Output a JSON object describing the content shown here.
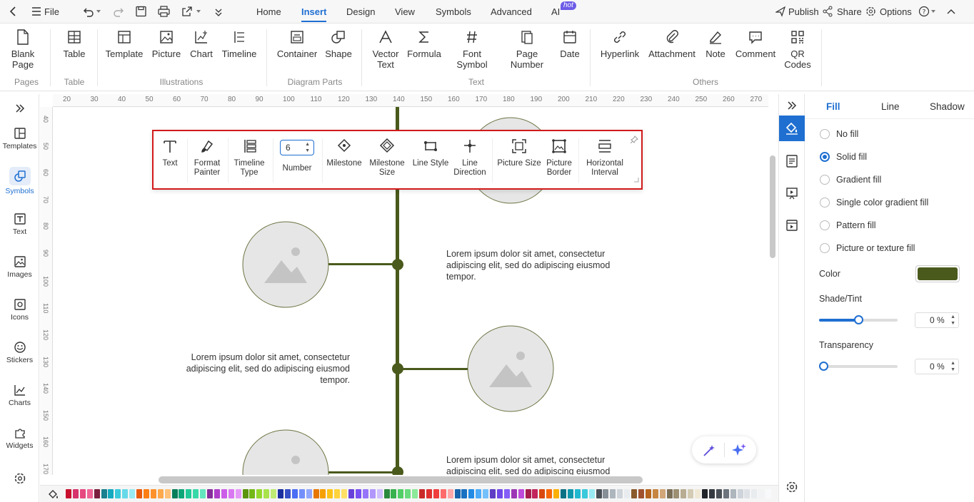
{
  "topbar": {
    "file": "File",
    "tabs": [
      "Home",
      "Insert",
      "Design",
      "View",
      "Symbols",
      "Advanced",
      "AI"
    ],
    "hot": "hot",
    "publish": "Publish",
    "share": "Share",
    "options": "Options"
  },
  "ribbon": {
    "buttons": {
      "blank_page": "Blank Page",
      "table": "Table",
      "template": "Template",
      "picture": "Picture",
      "chart": "Chart",
      "timeline": "Timeline",
      "container": "Container",
      "shape": "Shape",
      "vector_text": "Vector Text",
      "formula": "Formula",
      "font_symbol": "Font Symbol",
      "page_number": "Page Number",
      "date": "Date",
      "hyperlink": "Hyperlink",
      "attachment": "Attachment",
      "note": "Note",
      "comment": "Comment",
      "qr_codes": "QR Codes"
    },
    "groups": {
      "pages": "Pages",
      "table": "Table",
      "illustrations": "Illustrations",
      "diagram_parts": "Diagram Parts",
      "text": "Text",
      "others": "Others"
    }
  },
  "leftbar": [
    "Templates",
    "Symbols",
    "Text",
    "Images",
    "Icons",
    "Stickers",
    "Charts",
    "Widgets"
  ],
  "ruler": {
    "top": [
      "20",
      "30",
      "40",
      "50",
      "60",
      "70",
      "80",
      "90",
      "100",
      "110",
      "120",
      "130",
      "140",
      "150",
      "160",
      "170",
      "180",
      "190",
      "200",
      "210",
      "220",
      "230",
      "240",
      "250",
      "260",
      "270"
    ],
    "left": [
      "40",
      "50",
      "60",
      "70",
      "80",
      "90",
      "100",
      "110",
      "120",
      "130",
      "140",
      "150",
      "160",
      "170"
    ]
  },
  "floating_toolbar": {
    "text": "Text",
    "format_painter": "Format Painter",
    "timeline_type": "Timeline Type",
    "number_value": "6",
    "number": "Number",
    "milestone": "Milestone",
    "milestone_size": "Milestone Size",
    "line_style": "Line Style",
    "line_direction": "Line Direction",
    "picture_size": "Picture Size",
    "picture_border": "Picture Border",
    "horizontal_interval": "Horizontal Interval"
  },
  "canvas": {
    "lorem_a": "Lorem ipsum dolor sit amet, consectetur adipiscing elit, sed do adipiscing eiusmod tempor.",
    "lorem_b": "Lorem ipsum dolor sit amet, consectetur adipiscing elit, sed do adipiscing eiusmod tempor.",
    "lorem_c": "Lorem ipsum dolor sit amet, consectetur adipiscing elit, sed do adipiscing eiusmod"
  },
  "panel": {
    "tabs": [
      "Fill",
      "Line",
      "Shadow"
    ],
    "fill_options": [
      "No fill",
      "Solid fill",
      "Gradient fill",
      "Single color gradient fill",
      "Pattern fill",
      "Picture or texture fill"
    ],
    "selected_option": "Solid fill",
    "color_label": "Color",
    "color_value": "#4a5a1c",
    "shade_label": "Shade/Tint",
    "shade_value": "0 %",
    "shade_level": 0.5,
    "transparency_label": "Transparency",
    "transparency_value": "0 %",
    "transparency_level": 0
  },
  "colors": {
    "accent": "#1f6fd1",
    "timeline": "#4a5a1c",
    "highlight": "#d21a1a"
  },
  "palette": [
    "#c8102e",
    "#d6336c",
    "#e64980",
    "#f06595",
    "#7a1f3d",
    "#1a7f8e",
    "#15aabf",
    "#3bc9db",
    "#66d9e8",
    "#99e9f2",
    "#e8590c",
    "#fd7e14",
    "#ff922b",
    "#ffa94d",
    "#ffc078",
    "#087f5b",
    "#0ca678",
    "#20c997",
    "#38d9a9",
    "#63e6be",
    "#862e9c",
    "#ae3ec9",
    "#cc5de8",
    "#da77f2",
    "#e599f7",
    "#5c940d",
    "#74b816",
    "#94d82d",
    "#a9e34b",
    "#c0eb75",
    "#1c2f9e",
    "#364fc7",
    "#4c6ef5",
    "#748ffc",
    "#91a7ff",
    "#e67700",
    "#f59f00",
    "#fcc419",
    "#ffd43b",
    "#ffe066",
    "#6741d9",
    "#7950f2",
    "#9775fa",
    "#b197fc",
    "#d0bfff",
    "#2b8a3e",
    "#37b24d",
    "#51cf66",
    "#69db7c",
    "#8ce99a",
    "#c92a2a",
    "#e03131",
    "#f03e3e",
    "#ff6b6b",
    "#ffa8a8",
    "#1864ab",
    "#1971c2",
    "#228be6",
    "#4dabf7",
    "#74c0fc",
    "#5f3dc4",
    "#7048e8",
    "#845ef7",
    "#9c36b5",
    "#be4bdb",
    "#a61e4d",
    "#c2255c",
    "#d9480f",
    "#f76707",
    "#fab005",
    "#0b7285",
    "#1098ad",
    "#22b8cf",
    "#3bc9db",
    "#99e9f2",
    "#495057",
    "#868e96",
    "#adb5bd",
    "#ced4da",
    "#e9ecef",
    "#8b5a2b",
    "#a0522d",
    "#b5651d",
    "#c68642",
    "#d2a679",
    "#7c6f57",
    "#9c8f72",
    "#b8ad92",
    "#d4cbb4",
    "#efe8d5",
    "#212529",
    "#343a40",
    "#495057",
    "#6c757d",
    "#adb5bd",
    "#ced4da",
    "#dee2e6",
    "#e9ecef",
    "#f1f3f5",
    "#f8f9fa"
  ]
}
